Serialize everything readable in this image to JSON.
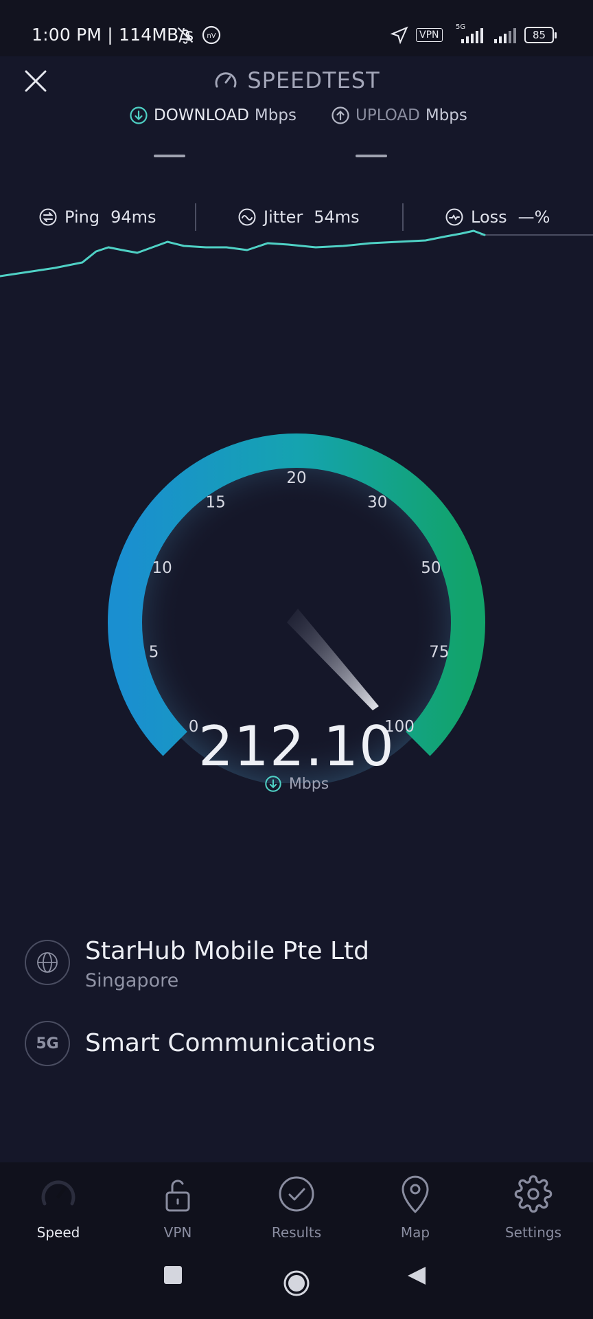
{
  "status_bar": {
    "time": "1:00 PM | 114MB/s",
    "vpn_label": "VPN",
    "network_label": "5G",
    "battery": "85"
  },
  "header": {
    "title": "SPEEDTEST",
    "download_label": "DOWNLOAD",
    "download_unit": "Mbps",
    "upload_label": "UPLOAD",
    "upload_unit": "Mbps"
  },
  "stats": {
    "ping_label": "Ping",
    "ping_value": "94ms",
    "jitter_label": "Jitter",
    "jitter_value": "54ms",
    "loss_label": "Loss",
    "loss_value": "—%"
  },
  "gauge": {
    "ticks": [
      "0",
      "5",
      "10",
      "15",
      "20",
      "30",
      "50",
      "75",
      "100"
    ],
    "value": "212.10",
    "unit": "Mbps",
    "colors": {
      "start": "#1a8fd0",
      "end": "#12a36a",
      "accent": "#4fd1c5"
    }
  },
  "provider": {
    "isp": "StarHub Mobile Pte Ltd",
    "location": "Singapore",
    "carrier_badge": "5G",
    "carrier": "Smart Communications"
  },
  "nav": {
    "items": [
      {
        "label": "Speed",
        "icon": "speedometer-icon"
      },
      {
        "label": "VPN",
        "icon": "unlock-icon"
      },
      {
        "label": "Results",
        "icon": "check-circle-icon"
      },
      {
        "label": "Map",
        "icon": "map-pin-icon"
      },
      {
        "label": "Settings",
        "icon": "gear-icon"
      }
    ],
    "active": "Speed"
  }
}
